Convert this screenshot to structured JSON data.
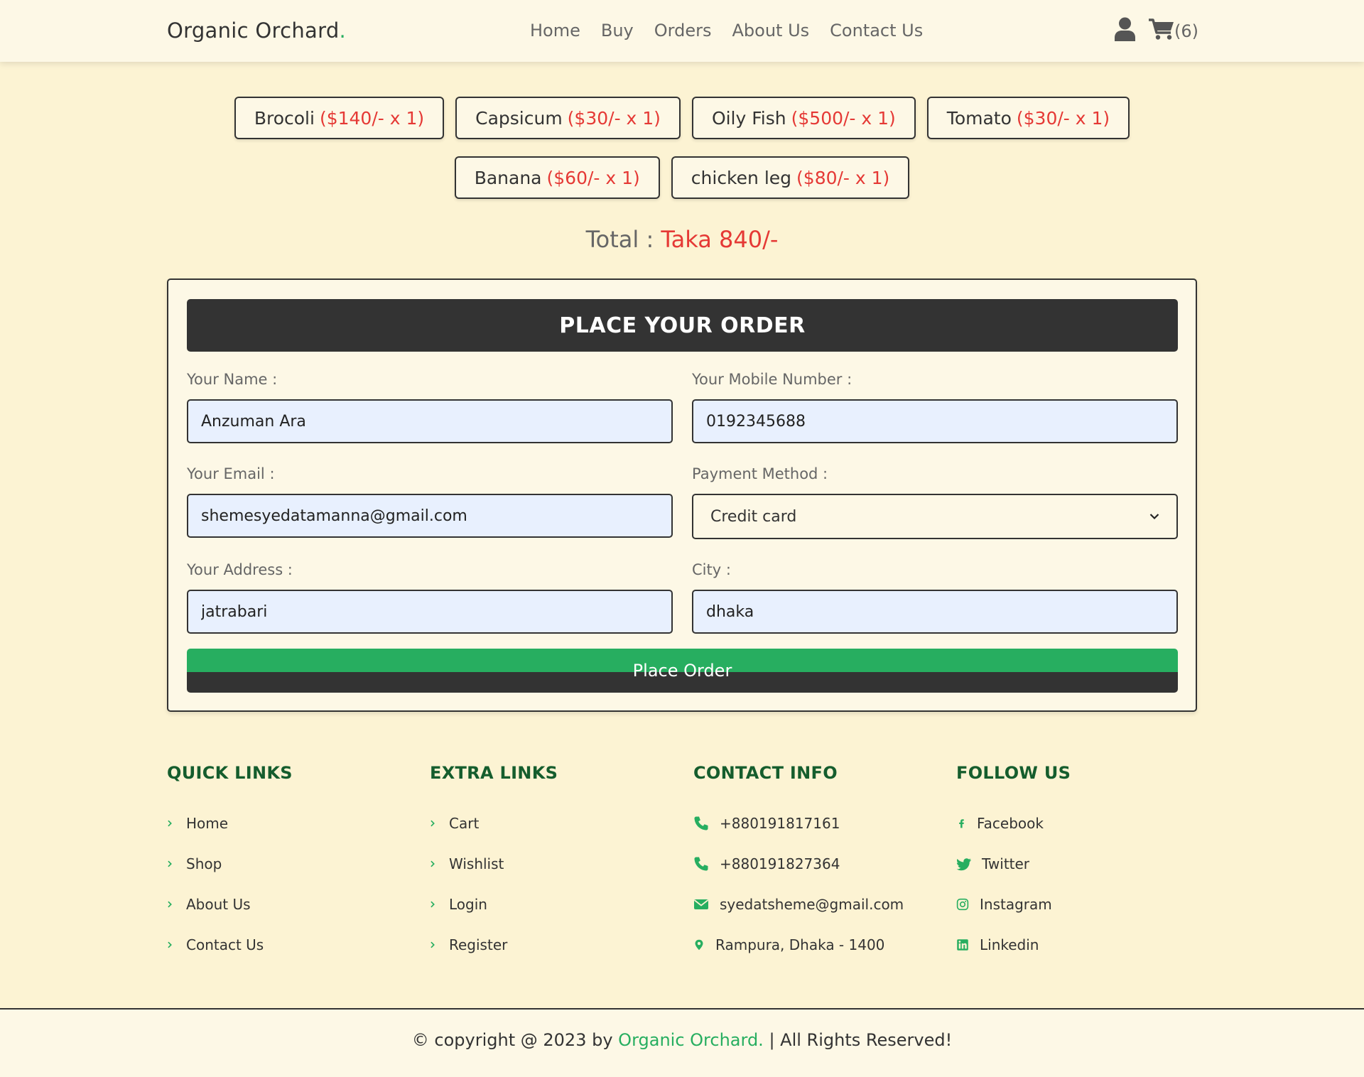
{
  "header": {
    "logo_text": "Organic Orchard",
    "logo_dot": ".",
    "nav": [
      "Home",
      "Buy",
      "Orders",
      "About Us",
      "Contact Us"
    ],
    "cart_count": "(6)"
  },
  "cart_items": [
    {
      "name": "Brocoli",
      "price": "($140/- x 1)"
    },
    {
      "name": "Capsicum",
      "price": "($30/- x 1)"
    },
    {
      "name": "Oily Fish",
      "price": "($500/- x 1)"
    },
    {
      "name": "Tomato",
      "price": "($30/- x 1)"
    },
    {
      "name": "Banana",
      "price": "($60/- x 1)"
    },
    {
      "name": "chicken leg",
      "price": "($80/- x 1)"
    }
  ],
  "total": {
    "label": "Total : ",
    "amount": "Taka 840/-"
  },
  "order_form": {
    "title": "PLACE YOUR ORDER",
    "name_label": "Your Name :",
    "name_value": "Anzuman Ara",
    "mobile_label": "Your Mobile Number :",
    "mobile_value": "0192345688",
    "email_label": "Your Email :",
    "email_value": "shemesyedatamanna@gmail.com",
    "payment_label": "Payment Method :",
    "payment_value": "Credit card",
    "address_label": "Your Address :",
    "address_value": "jatrabari",
    "city_label": "City :",
    "city_value": "dhaka",
    "submit_label": "Place Order"
  },
  "footer": {
    "quick_links": {
      "title": "QUICK LINKS",
      "items": [
        "Home",
        "Shop",
        "About Us",
        "Contact Us"
      ]
    },
    "extra_links": {
      "title": "EXTRA LINKS",
      "items": [
        "Cart",
        "Wishlist",
        "Login",
        "Register"
      ]
    },
    "contact_info": {
      "title": "CONTACT INFO",
      "phone1": "+880191817161",
      "phone2": "+880191827364",
      "email": "syedatsheme@gmail.com",
      "address": "Rampura, Dhaka - 1400"
    },
    "follow_us": {
      "title": "FOLLOW US",
      "items": [
        "Facebook",
        "Twitter",
        "Instagram",
        "Linkedin"
      ]
    },
    "copyright_prefix": "© copyright @ 2023 by ",
    "copyright_brand": "Organic Orchard.",
    "copyright_suffix": " | All Rights Reserved!"
  },
  "colors": {
    "accent_green": "#27ae60",
    "heading_green": "#155d2d",
    "price_red": "#e53935",
    "background": "#fcf3d3",
    "dark": "#333333"
  },
  "icons": [
    "user-icon",
    "cart-icon",
    "chevron-right-icon",
    "phone-icon",
    "envelope-icon",
    "map-marker-icon",
    "facebook-icon",
    "twitter-icon",
    "instagram-icon",
    "linkedin-icon",
    "chevron-down-icon"
  ]
}
